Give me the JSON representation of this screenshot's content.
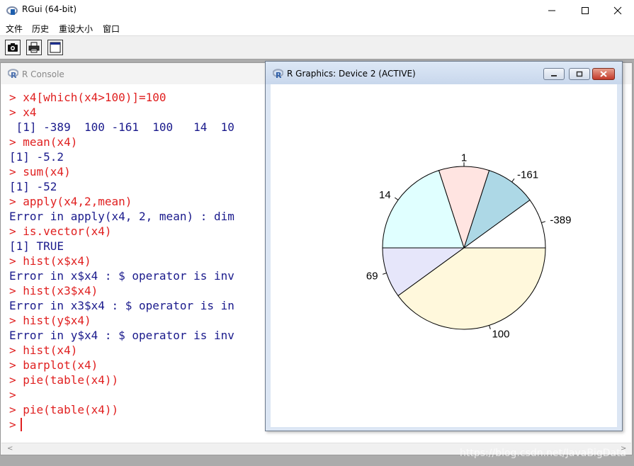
{
  "window": {
    "title": "RGui (64-bit)"
  },
  "menu": [
    "文件",
    "历史",
    "重设大小",
    "窗口"
  ],
  "toolbar": {
    "buttons": [
      "camera-icon",
      "printer-icon",
      "window-icon"
    ]
  },
  "console": {
    "title": "R Console",
    "lines": [
      {
        "text": "> x4[which(x4>100)]=100",
        "kind": "input"
      },
      {
        "text": "> x4",
        "kind": "input"
      },
      {
        "text": " [1] -389  100 -161  100   14  10",
        "kind": "output"
      },
      {
        "text": "> mean(x4)",
        "kind": "input"
      },
      {
        "text": "[1] -5.2",
        "kind": "output"
      },
      {
        "text": "> sum(x4)",
        "kind": "input"
      },
      {
        "text": "[1] -52",
        "kind": "output"
      },
      {
        "text": "> apply(x4,2,mean)",
        "kind": "input"
      },
      {
        "text": "Error in apply(x4, 2, mean) : dim",
        "kind": "output"
      },
      {
        "text": "> is.vector(x4)",
        "kind": "input"
      },
      {
        "text": "[1] TRUE",
        "kind": "output"
      },
      {
        "text": "> hist(x$x4)",
        "kind": "input"
      },
      {
        "text": "Error in x$x4 : $ operator is inv",
        "kind": "output"
      },
      {
        "text": "> hist(x3$x4)",
        "kind": "input"
      },
      {
        "text": "Error in x3$x4 : $ operator is in",
        "kind": "output"
      },
      {
        "text": "> hist(y$x4)",
        "kind": "input"
      },
      {
        "text": "Error in y$x4 : $ operator is inv",
        "kind": "output"
      },
      {
        "text": "> hist(x4)",
        "kind": "input"
      },
      {
        "text": "> barplot(x4)",
        "kind": "input"
      },
      {
        "text": "> pie(table(x4))",
        "kind": "input"
      },
      {
        "text": ">",
        "kind": "input"
      },
      {
        "text": "> pie(table(x4))",
        "kind": "input"
      },
      {
        "text": ">",
        "kind": "prompt"
      }
    ]
  },
  "graphics": {
    "title": "R Graphics: Device 2 (ACTIVE)"
  },
  "chart_data": {
    "type": "pie",
    "categories": [
      "-389",
      "-161",
      "1",
      "14",
      "69",
      "100"
    ],
    "values": [
      1,
      1,
      1,
      2,
      1,
      4
    ],
    "colors": [
      "#ffffff",
      "#add8e6",
      "#ffe4e1",
      "#e0ffff",
      "#e6e6fa",
      "#fff8dc"
    ],
    "start_angle_deg": 0,
    "direction": "counterclockwise"
  },
  "watermark": "https://blog.csdn.net/JavaBigData"
}
